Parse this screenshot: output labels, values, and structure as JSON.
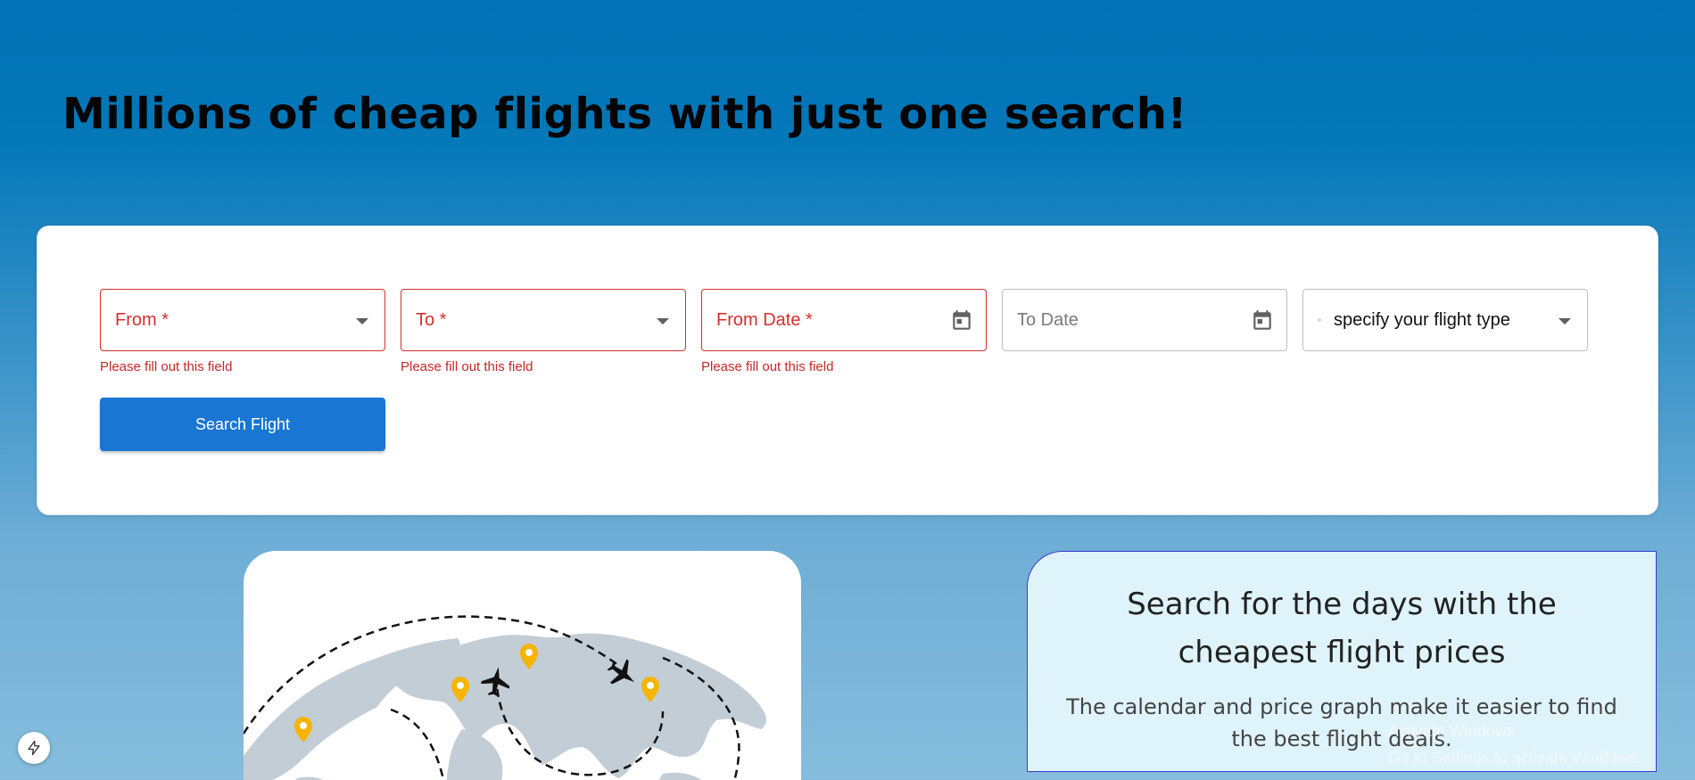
{
  "hero": {
    "title": "Millions of cheap flights with just one search!"
  },
  "search_form": {
    "from": {
      "label": "From *",
      "helper": "Please fill out this field",
      "icon": "chevron-down-icon"
    },
    "to": {
      "label": "To *",
      "helper": "Please fill out this field",
      "icon": "chevron-down-icon"
    },
    "from_date": {
      "label": "From Date *",
      "helper": "Please fill out this field",
      "icon": "calendar-icon"
    },
    "to_date": {
      "label": "To Date",
      "icon": "calendar-icon"
    },
    "flight_type": {
      "value": "specify your flight type",
      "icon": "chevron-down-icon"
    },
    "search_button": "Search Flight",
    "error_color": "#d32f2f",
    "button_color": "#1976d2"
  },
  "promo": {
    "title": "Search for the days with the cheapest flight prices",
    "subtitle": "The calendar and price graph make it easier to find the best flight deals."
  },
  "os_watermark": {
    "line1": "Activate Windows",
    "line2": "Go to Settings to activate Windows."
  },
  "fab_icon": "lightning-icon"
}
